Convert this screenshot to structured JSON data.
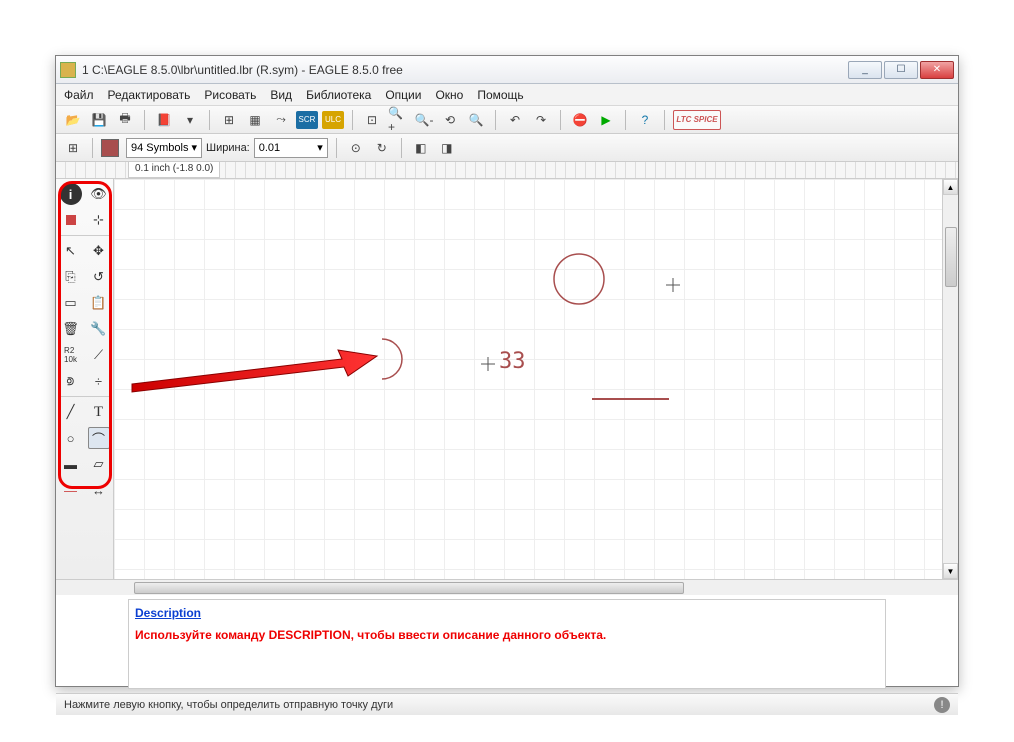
{
  "window": {
    "title": "1 C:\\EAGLE 8.5.0\\lbr\\untitled.lbr (R.sym) - EAGLE 8.5.0 free",
    "min_label": "_",
    "max_label": "☐",
    "close_label": "✕"
  },
  "menu": {
    "file": "Файл",
    "edit": "Редактировать",
    "draw": "Рисовать",
    "view": "Вид",
    "library": "Библиотека",
    "options": "Опции",
    "window": "Окно",
    "help": "Помощь"
  },
  "toolbar": {
    "scr_label": "SCR",
    "ulc_label": "ULC",
    "ltc_label": "LTC SPICE"
  },
  "layer": {
    "name": "94 Symbols",
    "width_label": "Ширина:",
    "width_value": "0.01"
  },
  "ruler": {
    "coords": "0.1 inch (-1.8 0.0)"
  },
  "canvas": {
    "text_value": "33"
  },
  "description": {
    "link_label": "Description",
    "body": "Используйте команду DESCRIPTION, чтобы ввести описание данного объекта."
  },
  "status": {
    "text": "Нажмите левую кнопку, чтобы определить отправную точку дуги"
  },
  "tool_icons": {
    "info": "ⓘ",
    "show": "👁",
    "layers": "▦",
    "mark": "⊹",
    "select": "↖",
    "move": "✥",
    "copy": "⎘",
    "rotate": "↺",
    "group": "▭",
    "paste": "📋",
    "delete": "🗑",
    "change": "🔧",
    "name": "R2",
    "value": "⟋",
    "miter": "⟄",
    "split": "÷",
    "wire": "╱",
    "text": "T",
    "circle": "○",
    "arc": "⌒",
    "rect": "▬",
    "polygon": "▱",
    "pin": "—",
    "dimension": "↔"
  }
}
